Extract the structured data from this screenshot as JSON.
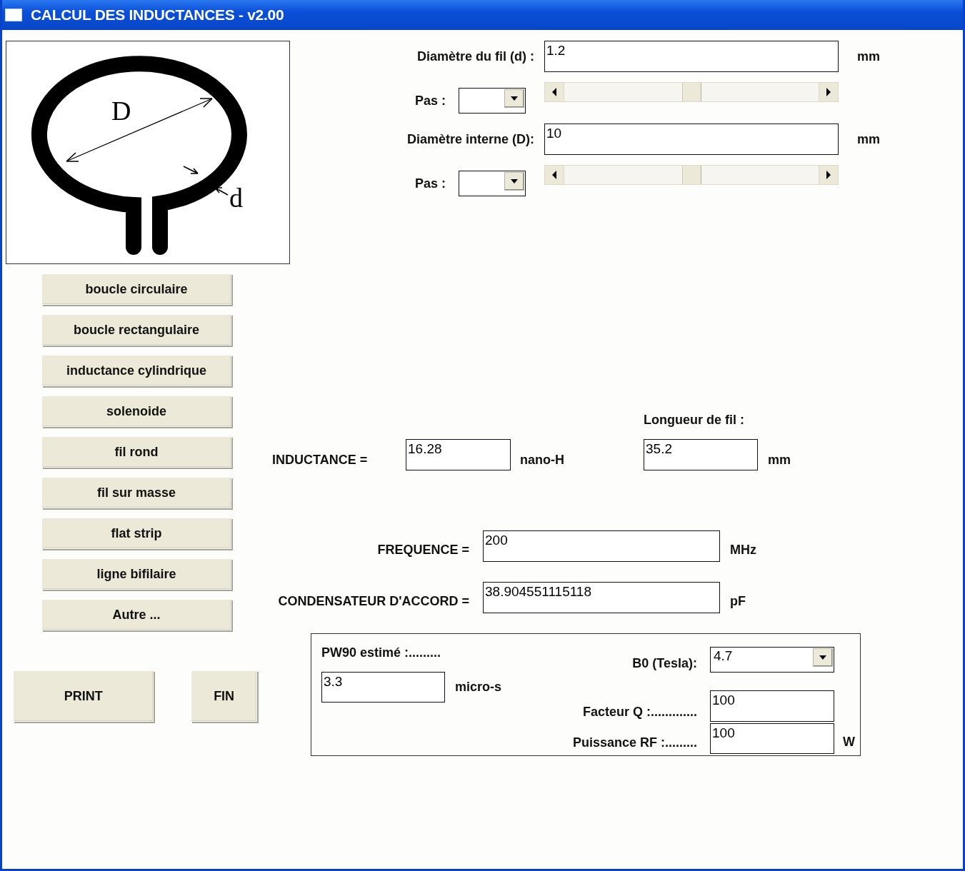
{
  "window": {
    "title": "CALCUL DES INDUCTANCES - v2.00"
  },
  "diagram": {
    "diameter_label": "D",
    "wire_label": "d"
  },
  "parameters": [
    {
      "label": "Diamètre du fil (d) :",
      "value": "1.2",
      "unit": "mm",
      "step_label": "Pas :",
      "level": 0.5
    },
    {
      "label": "Diamètre interne (D):",
      "value": "10",
      "unit": "mm",
      "step_label": "Pas :",
      "level": 0.5
    }
  ],
  "shape_buttons": [
    "boucle circulaire",
    "boucle rectangulaire",
    "inductance cylindrique",
    "solenoide",
    "fil rond",
    "fil sur masse",
    "flat strip",
    "ligne bifilaire",
    "Autre ..."
  ],
  "actions": [
    "PRINT",
    "FIN"
  ],
  "inductance": {
    "label": "INDUCTANCE =",
    "value": "16.28",
    "unit": "nano-H"
  },
  "wire_length": {
    "label": "Longueur de fil :",
    "value": "35.2",
    "unit": "mm"
  },
  "results": [
    {
      "label": "FREQUENCE =",
      "value": "200",
      "unit": "MHz"
    },
    {
      "label": "CONDENSATEUR D'ACCORD =",
      "value": "38.904551115118",
      "unit": "pF"
    }
  ],
  "rf": {
    "pulse": {
      "label": "PW90 estimé :.........",
      "value": "3.3",
      "unit": "micro-s"
    },
    "b0": {
      "label": "B0 (Tesla):",
      "value": "4.7"
    },
    "q_factor": {
      "label": "Facteur Q :.............",
      "value": "100"
    },
    "rf_power": {
      "label": "Puissance RF :.........",
      "value": "100",
      "unit": "W"
    }
  }
}
